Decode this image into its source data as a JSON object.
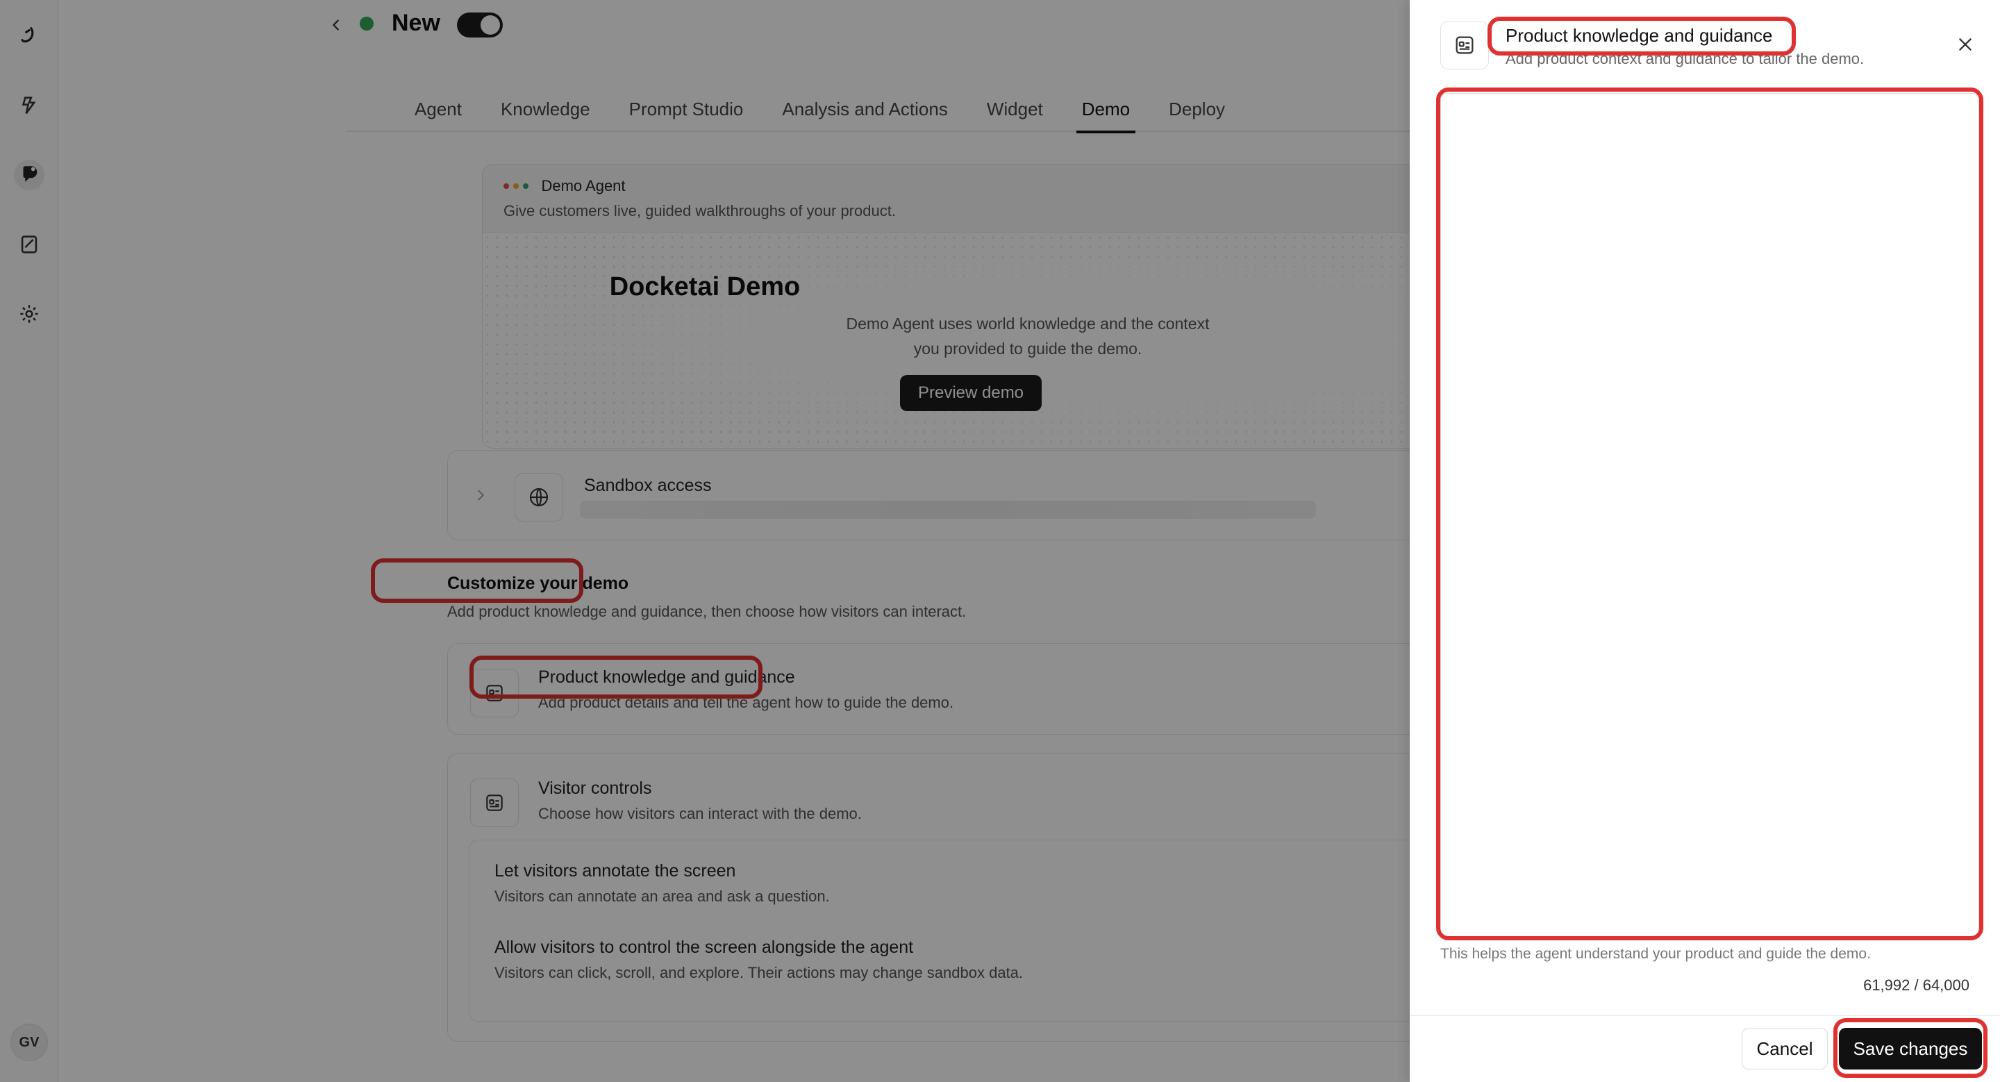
{
  "app": {
    "title": "New",
    "status_color": "#34a853",
    "toggle_on": true,
    "user_initials": "GV"
  },
  "rail": {
    "icons": [
      "brand-logo-icon",
      "agent-icon",
      "chat-icon",
      "document-icon",
      "gear-icon"
    ]
  },
  "tabs": [
    {
      "label": "Agent"
    },
    {
      "label": "Knowledge"
    },
    {
      "label": "Prompt Studio"
    },
    {
      "label": "Analysis and Actions"
    },
    {
      "label": "Widget"
    },
    {
      "label": "Demo",
      "active": true
    },
    {
      "label": "Deploy"
    }
  ],
  "preview": {
    "agent_name": "Demo Agent",
    "subtitle": "Give customers live, guided walkthroughs of your product.",
    "demo_title": "Docketai Demo",
    "demo_desc": "Demo Agent uses world knowledge and the context you provided to guide the demo.",
    "button": "Preview demo"
  },
  "sandbox": {
    "label": "Sandbox access"
  },
  "customize": {
    "title": "Customize your demo",
    "subtitle": "Add product knowledge and guidance, then choose how visitors can interact."
  },
  "knowledge_card": {
    "title": "Product knowledge and guidance",
    "subtitle": "Add product details and tell the agent how to guide the demo."
  },
  "visitor_card": {
    "title": "Visitor controls",
    "subtitle": "Choose how visitors can interact with the demo.",
    "options": [
      {
        "title": "Let visitors annotate the screen",
        "subtitle": "Visitors can annotate an area and ask a question."
      },
      {
        "title": "Allow visitors to control the screen alongside the agent",
        "subtitle": "Visitors can click, scroll, and explore. Their actions may change sandbox data."
      }
    ]
  },
  "drawer": {
    "title": "Product knowledge and guidance",
    "subtitle": "Add product context and guidance to tailor the demo.",
    "textarea_value": "",
    "helper": "This helps the agent understand your product and guide the demo.",
    "counter": "61,992 / 64,000",
    "cancel": "Cancel",
    "save": "Save changes"
  },
  "highlight_color": "#e03131"
}
